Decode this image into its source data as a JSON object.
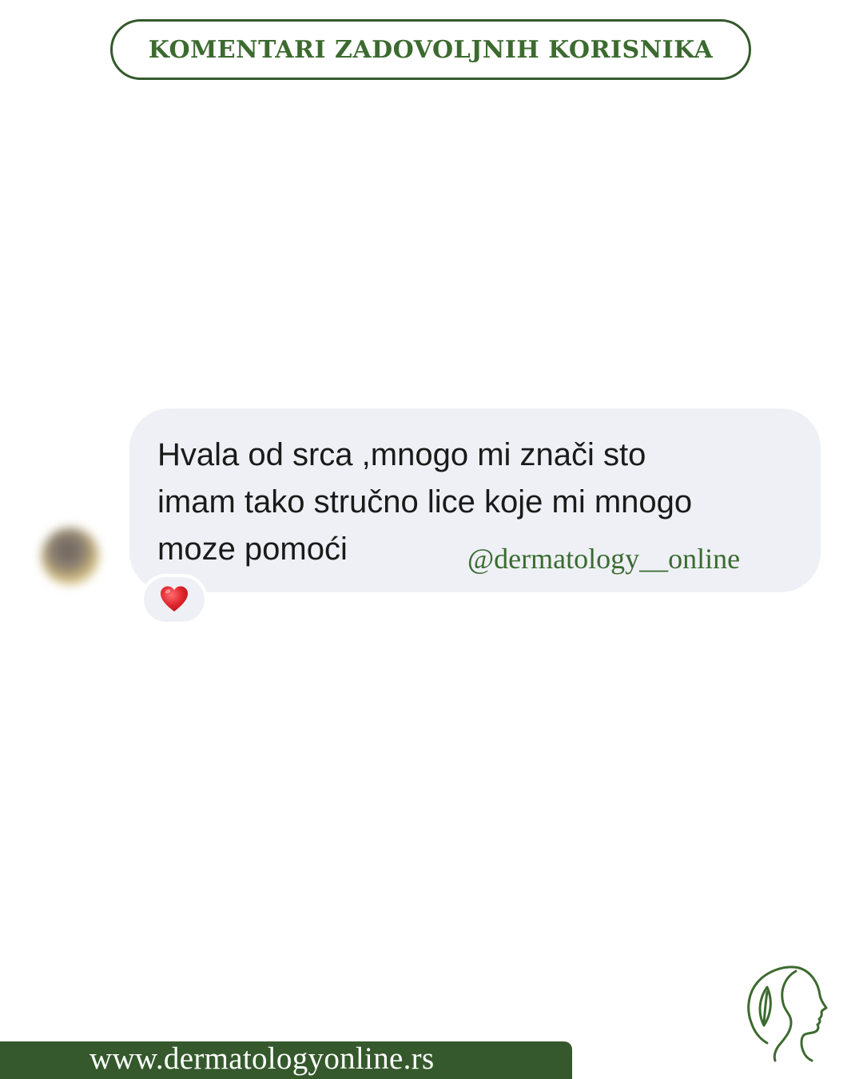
{
  "header": {
    "title": "KOMENTARI ZADOVOLJNIH KORISNIKA"
  },
  "message": {
    "text": "Hvala od srca ,mnogo mi znači sto\nimam tako stručno lice koje mi mnogo\nmoze pomoći",
    "reaction_icon": "red-heart-icon"
  },
  "watermark": {
    "handle": "@dermatology__online"
  },
  "footer": {
    "url": "www.dermatologyonline.rs",
    "logo_icon": "face-leaf-logo"
  },
  "colors": {
    "brand_green": "#35592c",
    "text_green": "#3c6a2f",
    "bubble_bg": "#eff0f5",
    "heart_red": "#e0242c"
  }
}
